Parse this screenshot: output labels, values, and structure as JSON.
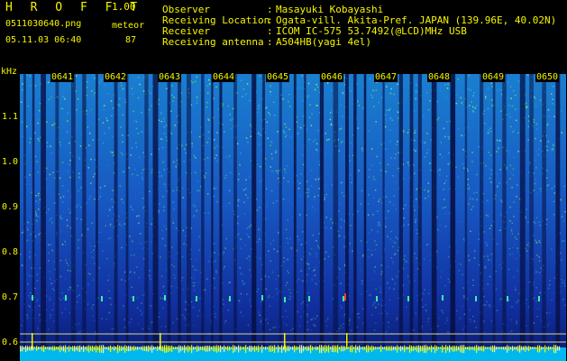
{
  "app": {
    "title": "H R O F F T",
    "version": "1.00"
  },
  "file": {
    "name": "0511030640.png",
    "datetime": "05.11.03 06:40"
  },
  "meteor": {
    "label": "meteor",
    "count": "87"
  },
  "info": [
    {
      "label": "Observer",
      "value": "Masayuki Kobayashi"
    },
    {
      "label": "Receiving Location",
      "value": "Ogata-vill. Akita-Pref. JAPAN (139.96E, 40.02N)"
    },
    {
      "label": "Receiver",
      "value": "ICOM IC-575 53.7492(@LCD)MHz USB"
    },
    {
      "label": "Receiving antenna",
      "value": "A504HB(yagi 4el)"
    }
  ],
  "colors": {
    "header_text": "#f5f500",
    "background": "#000000",
    "info_text": "#f5f500",
    "meteor_head": "#ff3030"
  },
  "spectrogram": {
    "y_unit": "kHz",
    "y_ticks": [
      "1.1",
      "1.0",
      "0.9",
      "0.8",
      "0.7",
      "0.6"
    ],
    "x_ticks": [
      "0641",
      "0642",
      "0643",
      "0644",
      "0645",
      "0646",
      "0647",
      "0648",
      "0649",
      "0650"
    ]
  }
}
